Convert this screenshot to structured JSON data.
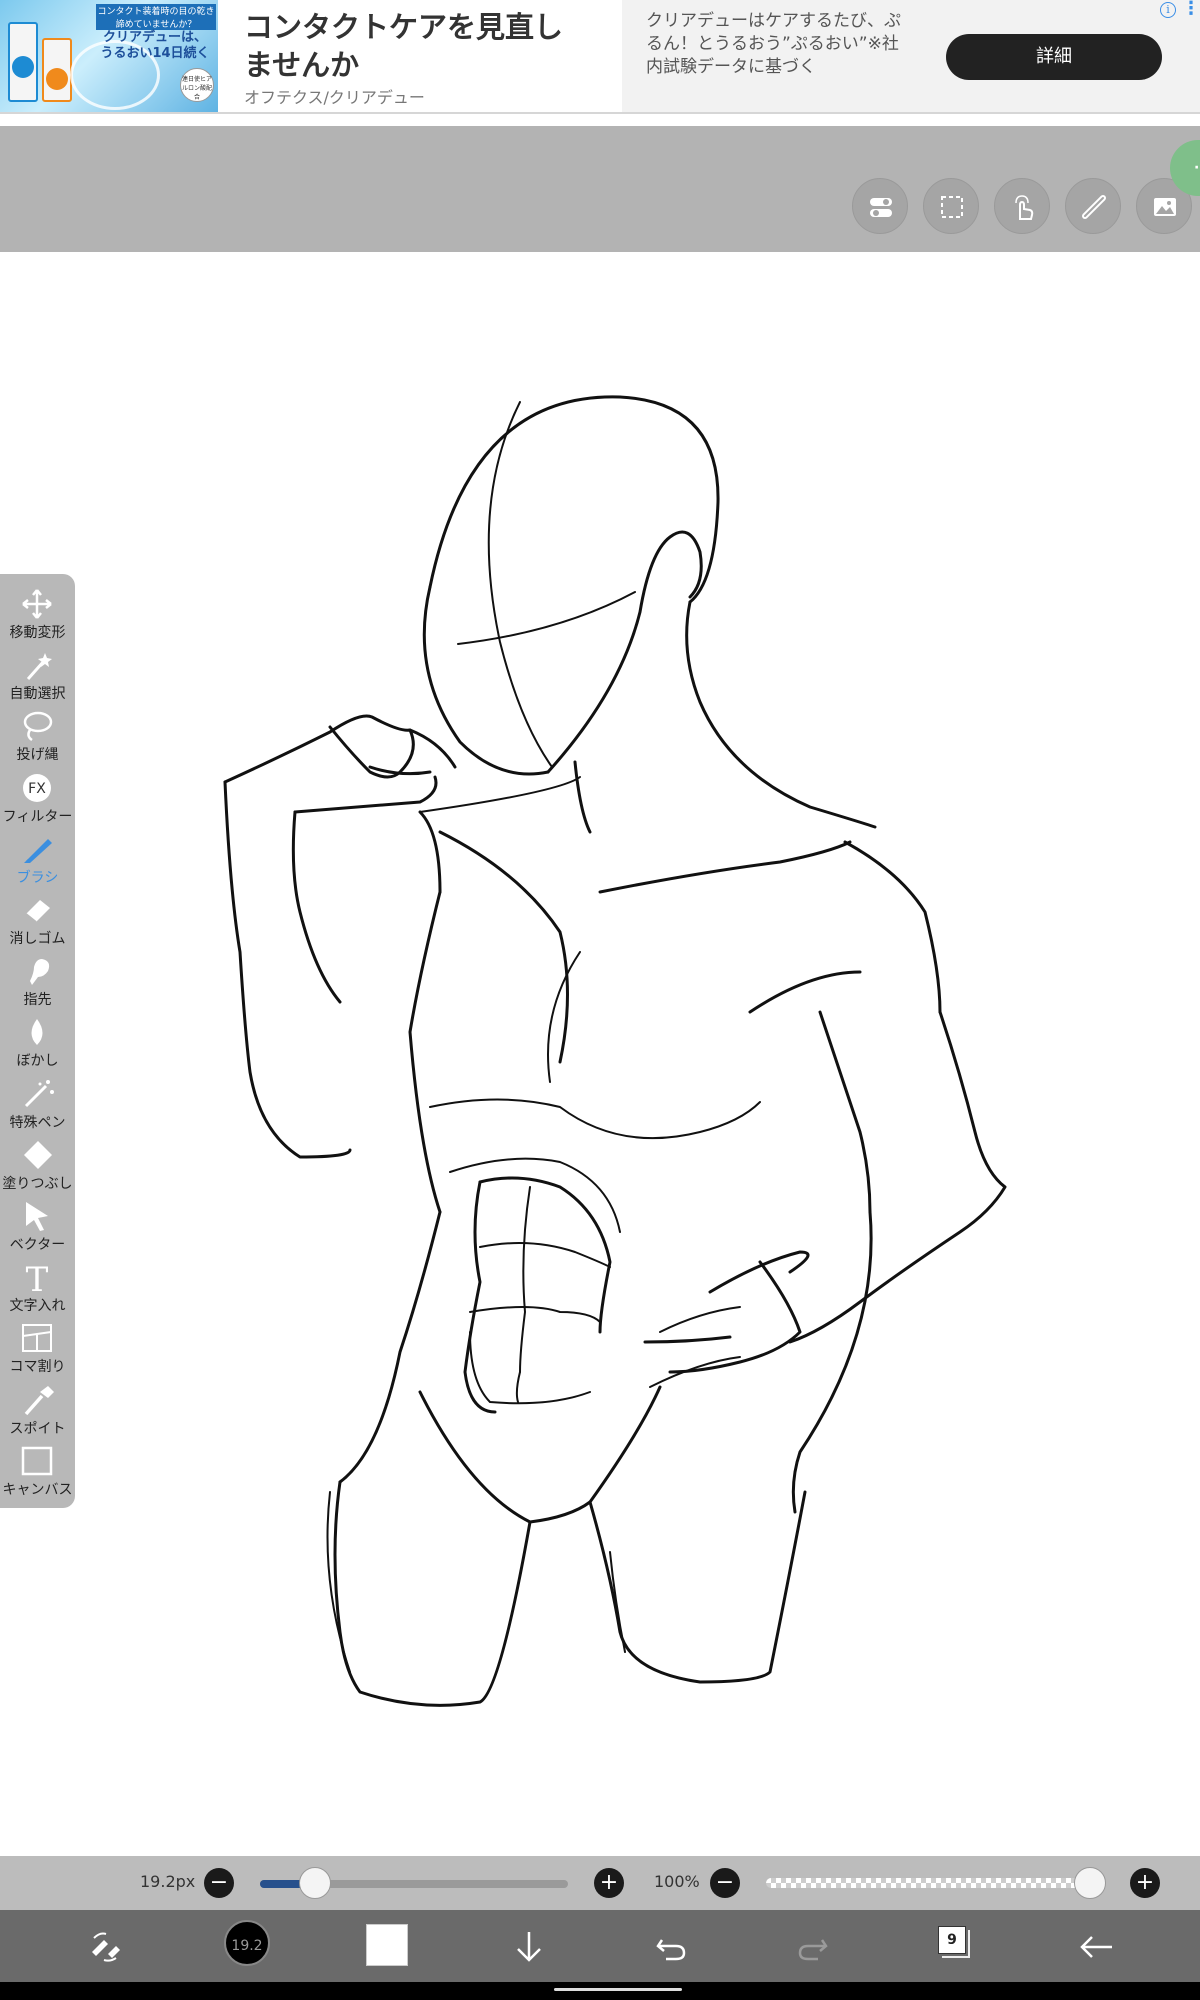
{
  "ad": {
    "image_text_top": "コンタクト装着時の目の乾き諦めていませんか？",
    "image_text_main": "クリアデューは、うるおい14日続く",
    "image_badge": "連日使ヒアルロン酸配合",
    "headline": "コンタクトケアを見直しませんか",
    "advertiser": "オフテクス/クリアデュー",
    "description": "クリアデューはケアするたび、ぷるん！とうるおう”ぷるおい”※社内試験データに基づく",
    "button_label": "詳細",
    "info_icon": "i",
    "more_icon": "⋮"
  },
  "top_toolbar": {
    "buttons": [
      "toggle-icon",
      "selection-icon",
      "touch-icon",
      "ruler-icon",
      "image-icon"
    ],
    "floating_menu": "··"
  },
  "tools": [
    {
      "label": "移動変形",
      "icon": "move-icon"
    },
    {
      "label": "自動選択",
      "icon": "magic-wand-icon"
    },
    {
      "label": "投げ縄",
      "icon": "lasso-icon"
    },
    {
      "label": "フィルター",
      "icon": "fx-icon",
      "glyph": "FX"
    },
    {
      "label": "ブラシ",
      "icon": "brush-icon",
      "active": true
    },
    {
      "label": "消しゴム",
      "icon": "eraser-icon"
    },
    {
      "label": "指先",
      "icon": "smudge-icon"
    },
    {
      "label": "ぼかし",
      "icon": "blur-drop-icon"
    },
    {
      "label": "特殊ペン",
      "icon": "special-pen-icon"
    },
    {
      "label": "塗りつぶし",
      "icon": "fill-bucket-icon"
    },
    {
      "label": "ベクター",
      "icon": "vector-cursor-icon"
    },
    {
      "label": "文字入れ",
      "icon": "text-icon",
      "glyph": "T"
    },
    {
      "label": "コマ割り",
      "icon": "frame-divide-icon"
    },
    {
      "label": "スポイト",
      "icon": "eyedropper-icon"
    },
    {
      "label": "キャンバス",
      "icon": "canvas-icon"
    }
  ],
  "slider_bar": {
    "size_value": "19.2px",
    "size_fraction": 0.18,
    "opacity_value": "100%",
    "opacity_fraction": 1.0,
    "minus": "−",
    "plus": "+"
  },
  "bottom_toolbar": {
    "brush_size": "19.2",
    "layer_count": "9",
    "color": "#ffffff"
  }
}
